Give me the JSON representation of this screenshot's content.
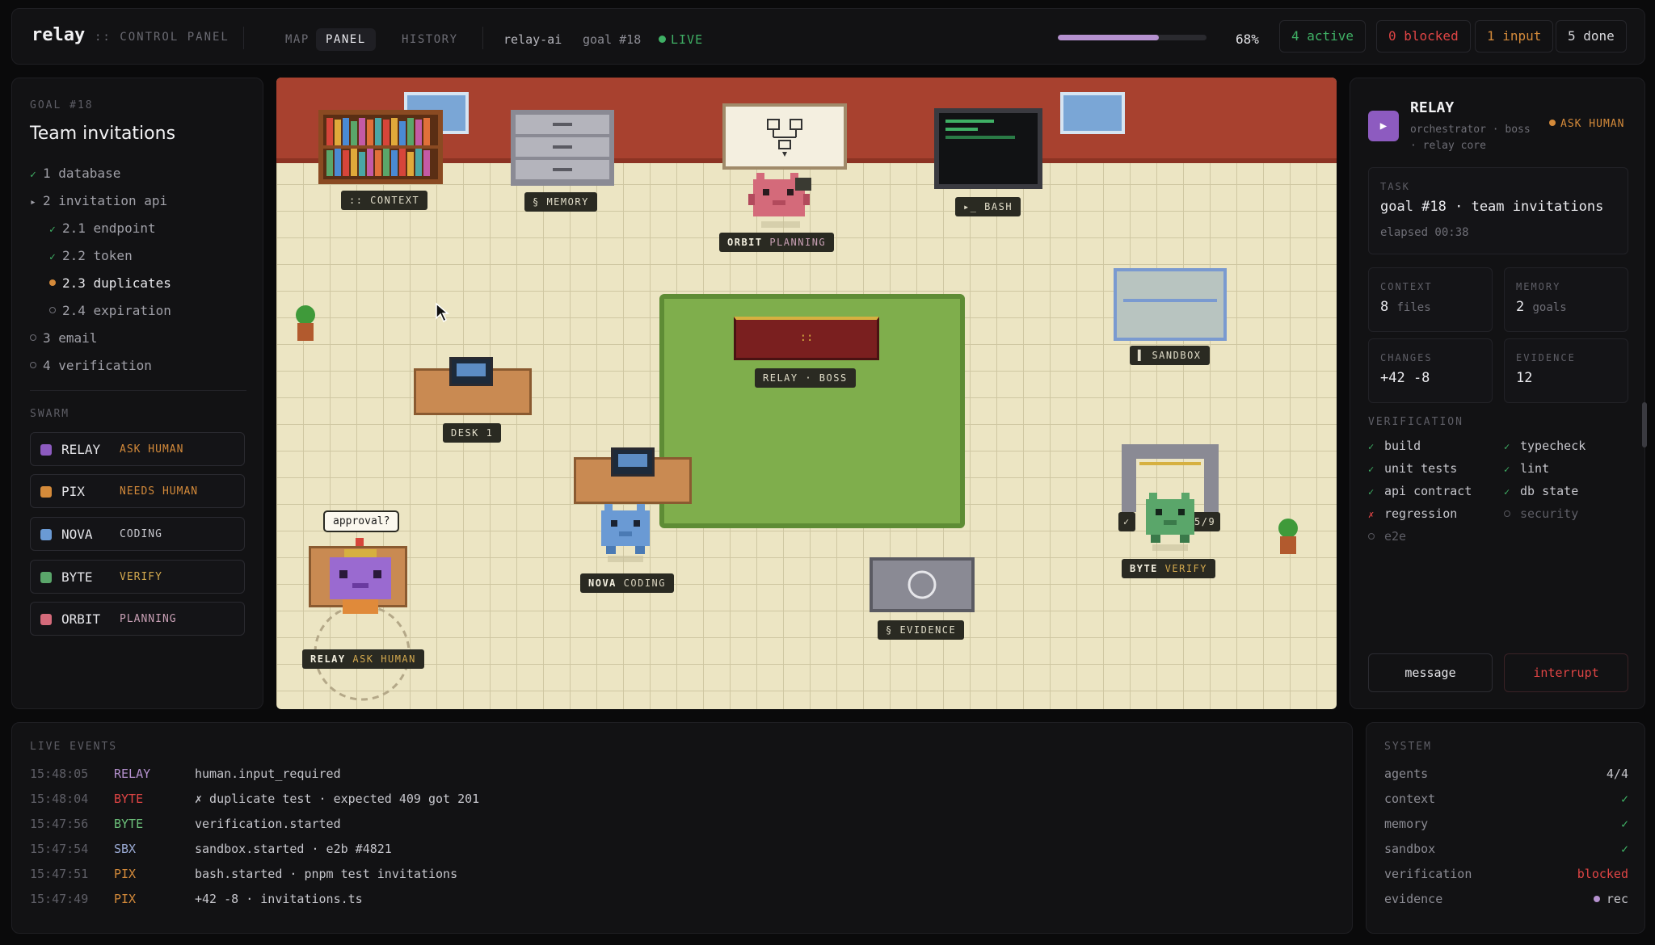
{
  "colors": {
    "relay": "#8d5bc0",
    "pix": "#d48a3a",
    "nova": "#6a9ad4",
    "byte": "#5aa66a",
    "orbit": "#d46a7a",
    "live": "#3fb065",
    "blocked": "#e04545",
    "progress": "#b591cf"
  },
  "header": {
    "brand": "relay",
    "subtitle": ":: CONTROL PANEL",
    "tabs": [
      "MAP",
      "PANEL",
      "HISTORY"
    ],
    "active_tab": "PANEL",
    "project": "relay-ai",
    "goal": "goal #18",
    "live": "LIVE",
    "progress_fraction": 0.68,
    "progress_label": "68%",
    "stats": {
      "active": "4 active",
      "blocked": "0 blocked",
      "input": "1 input",
      "done": "5 done"
    }
  },
  "goal": {
    "label": "GOAL #18",
    "title": "Team invitations",
    "tasks": [
      {
        "label": "1 database",
        "state": "done"
      },
      {
        "label": "2 invitation api",
        "state": "open"
      },
      {
        "label": "2.1 endpoint",
        "state": "done"
      },
      {
        "label": "2.2 token",
        "state": "done"
      },
      {
        "label": "2.3 duplicates",
        "state": "current"
      },
      {
        "label": "2.4 expiration",
        "state": "pending"
      },
      {
        "label": "3 email",
        "state": "pending"
      },
      {
        "label": "4 verification",
        "state": "pending"
      }
    ],
    "markers": {
      "done": "✓",
      "open": "▸"
    }
  },
  "swarm": {
    "label": "SWARM",
    "agents": [
      {
        "name": "RELAY",
        "status": "ASK HUMAN"
      },
      {
        "name": "PIX",
        "status": "NEEDS HUMAN"
      },
      {
        "name": "NOVA",
        "status": "CODING"
      },
      {
        "name": "BYTE",
        "status": "VERIFY"
      },
      {
        "name": "ORBIT",
        "status": "PLANNING"
      }
    ]
  },
  "map": {
    "context": ":: CONTEXT",
    "memory": "§ MEMORY",
    "bash": "▸_ BASH",
    "sandbox": "▌ SANDBOX",
    "desk1": "DESK 1",
    "boss": "RELAY · BOSS",
    "boss_desk_mark": "::",
    "evidence": "§ EVIDENCE",
    "orbit_name": "ORBIT",
    "orbit_status": "PLANNING",
    "nova_name": "NOVA",
    "nova_status": "CODING",
    "byte_name": "BYTE",
    "byte_status": "VERIFY",
    "relay_name": "RELAY",
    "relay_status": "ASK HUMAN",
    "approval": "approval?",
    "byte_progress": "5/9"
  },
  "detail": {
    "name": "RELAY",
    "avatar": "▶",
    "sub1": "orchestrator · boss",
    "sub2": "· relay core",
    "status": "ASK HUMAN",
    "task_label": "TASK",
    "task_value": "goal #18 · team invitations",
    "elapsed": "elapsed 00:38",
    "context_label": "CONTEXT",
    "context_value": "8",
    "context_unit": "files",
    "memory_label": "MEMORY",
    "memory_value": "2",
    "memory_unit": "goals",
    "changes_label": "CHANGES",
    "changes_value": "+42 -8",
    "evidence_label": "EVIDENCE",
    "evidence_value": "12",
    "verification_label": "VERIFICATION",
    "checks": [
      {
        "label": "build",
        "state": "ok"
      },
      {
        "label": "typecheck",
        "state": "ok"
      },
      {
        "label": "unit tests",
        "state": "ok"
      },
      {
        "label": "lint",
        "state": "ok"
      },
      {
        "label": "api contract",
        "state": "ok"
      },
      {
        "label": "db state",
        "state": "ok"
      },
      {
        "label": "regression",
        "state": "fail"
      },
      {
        "label": "security",
        "state": "pending"
      },
      {
        "label": "e2e",
        "state": "pending"
      }
    ],
    "check_marks": {
      "ok": "✓",
      "fail": "✗"
    },
    "message_button": "message",
    "interrupt_button": "interrupt"
  },
  "events": {
    "label": "LIVE EVENTS",
    "rows": [
      {
        "time": "15:48:05",
        "agent": "RELAY",
        "msg": "human.input_required"
      },
      {
        "time": "15:48:04",
        "agent": "BYTE",
        "msg": "✗ duplicate test · expected 409 got 201"
      },
      {
        "time": "15:47:56",
        "agent": "BYTE",
        "msg": "verification.started"
      },
      {
        "time": "15:47:54",
        "agent": "SBX",
        "msg": "sandbox.started · e2b #4821"
      },
      {
        "time": "15:47:51",
        "agent": "PIX",
        "msg": "bash.started · pnpm test invitations"
      },
      {
        "time": "15:47:49",
        "agent": "PIX",
        "msg": "+42 -8 · invitations.ts"
      }
    ]
  },
  "system": {
    "label": "SYSTEM",
    "rows": [
      {
        "key": "agents",
        "value": "4/4",
        "state": "plain"
      },
      {
        "key": "context",
        "value": "✓",
        "state": "ok"
      },
      {
        "key": "memory",
        "value": "✓",
        "state": "ok"
      },
      {
        "key": "sandbox",
        "value": "✓",
        "state": "ok"
      },
      {
        "key": "verification",
        "value": "blocked",
        "state": "bad"
      },
      {
        "key": "evidence",
        "value": "rec",
        "state": "rec"
      }
    ]
  }
}
